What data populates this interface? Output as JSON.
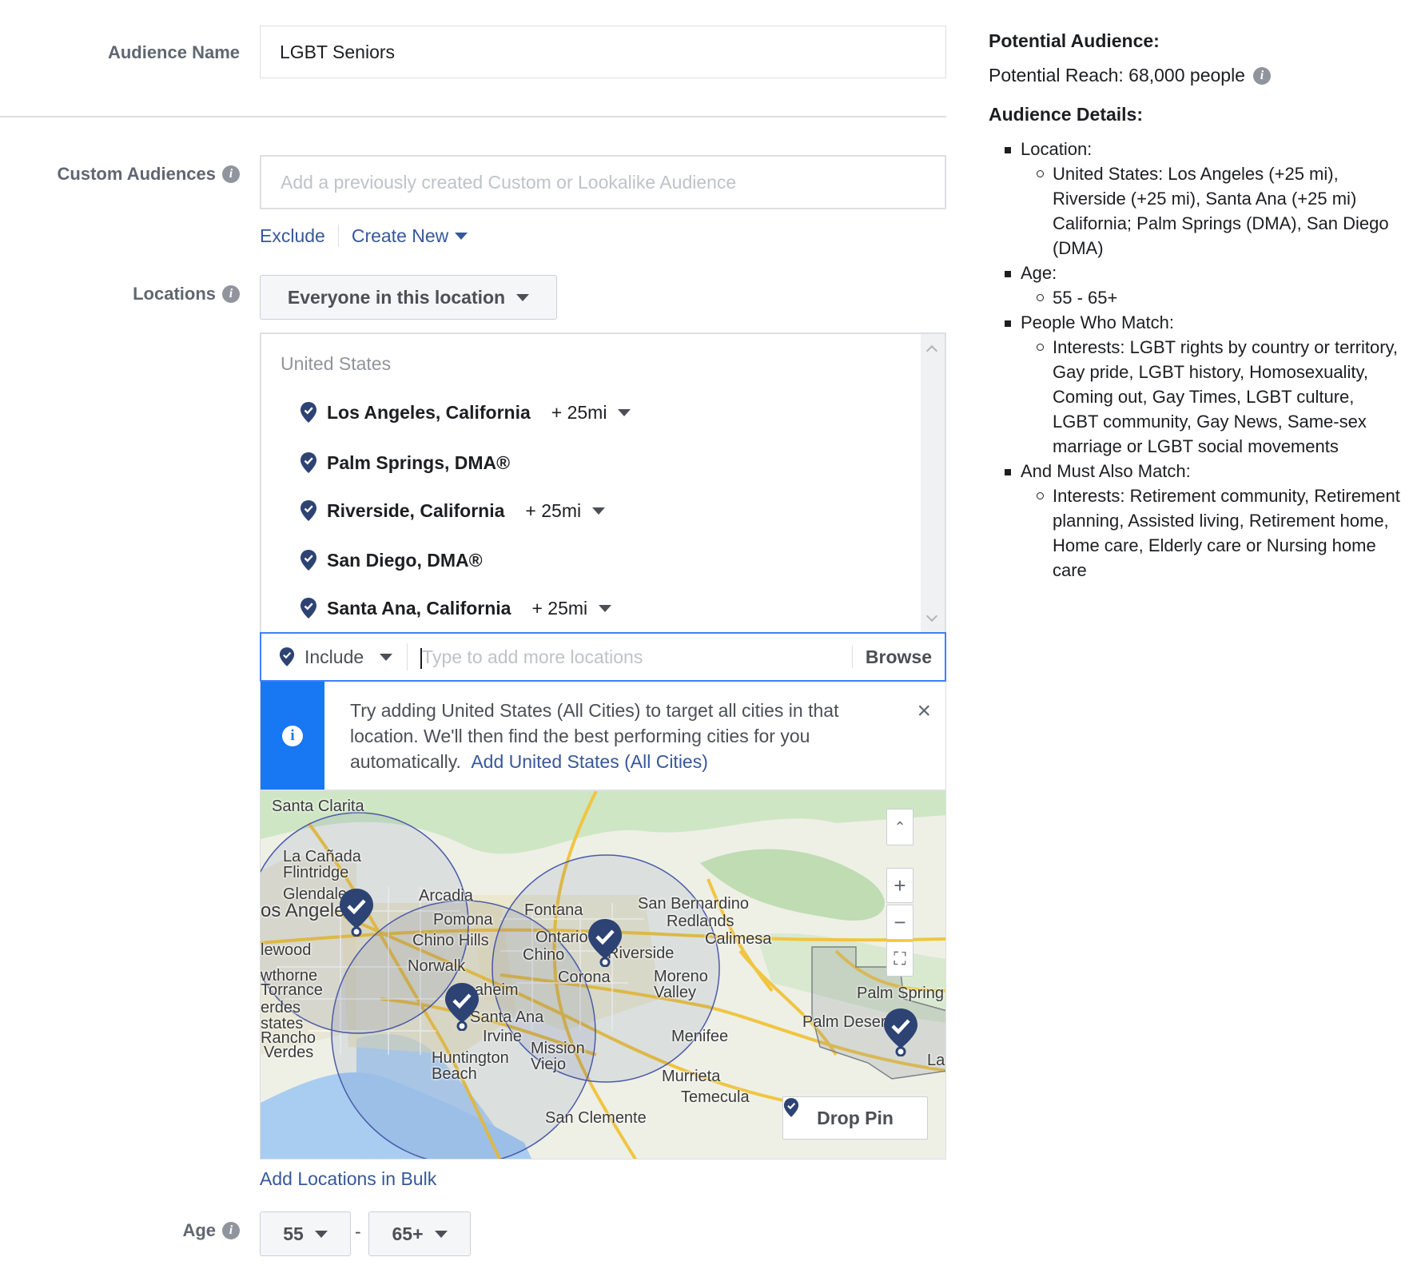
{
  "audience_name": {
    "label": "Audience Name",
    "value": "LGBT Seniors"
  },
  "custom_audiences": {
    "label": "Custom Audiences",
    "placeholder": "Add a previously created Custom or Lookalike Audience",
    "exclude_label": "Exclude",
    "create_new_label": "Create New"
  },
  "locations": {
    "label": "Locations",
    "mode_label": "Everyone in this location",
    "country": "United States",
    "items": [
      {
        "name": "Los Angeles, California",
        "radius": "+ 25mi"
      },
      {
        "name": "Palm Springs, DMA®",
        "radius": ""
      },
      {
        "name": "Riverside, California",
        "radius": "+ 25mi"
      },
      {
        "name": "San Diego, DMA®",
        "radius": ""
      },
      {
        "name": "Santa Ana, California",
        "radius": "+ 25mi"
      }
    ],
    "include_label": "Include",
    "input_placeholder": "Type to add more locations",
    "browse_label": "Browse",
    "tip": {
      "text": "Try adding United States (All Cities) to target all cities in that location. We'll then find the best performing cities for you automatically.",
      "link": "Add United States (All Cities)",
      "close": "×"
    },
    "map": {
      "labels": [
        "Santa Clarita",
        "La Cañada Flintridge",
        "Glendale",
        "os Angeles",
        "Arcadia",
        "Pomona",
        "Chino Hills",
        "Fontana",
        "San Bernardino",
        "Redlands",
        "Calimesa",
        "Ontario",
        "Chino",
        "Riverside",
        "lewood",
        "Norwalk",
        "wthorne",
        "Torrance",
        "Corona",
        "Moreno Valley",
        "erdes",
        "states",
        "Rancho",
        "Verdes",
        "aheim",
        "Santa Ana",
        "Irvine",
        "Mission Viejo",
        "Huntington Beach",
        "Menifee",
        "Murrieta",
        "Temecula",
        "San Clemente",
        "Palm Spring",
        "Palm Desert",
        "La"
      ],
      "zoom_in": "+",
      "zoom_out": "−",
      "collapse": "⌃",
      "fit": "⛶",
      "drop_pin_label": "Drop Pin"
    },
    "bulk_link": "Add Locations in Bulk"
  },
  "age": {
    "label": "Age",
    "min": "55",
    "separator": "-",
    "max": "65+"
  },
  "summary": {
    "potential_audience_title": "Potential Audience:",
    "potential_reach": "Potential Reach: 68,000 people",
    "details_title": "Audience Details:",
    "sections": [
      {
        "title": "Location:",
        "items": [
          "United States: Los Angeles (+25 mi), Riverside (+25 mi), Santa Ana (+25 mi) California; Palm Springs (DMA), San Diego (DMA)"
        ]
      },
      {
        "title": "Age:",
        "items": [
          "55 - 65+"
        ]
      },
      {
        "title": "People Who Match:",
        "items": [
          "Interests: LGBT rights by country or territory, Gay pride, LGBT history, Homosexuality, Coming out, Gay Times, LGBT culture, LGBT community, Gay News, Same-sex marriage or LGBT social movements"
        ]
      },
      {
        "title": "And Must Also Match:",
        "items": [
          "Interests: Retirement community, Retirement planning, Assisted living, Retirement home, Home care, Elderly care or Nursing home care"
        ]
      }
    ]
  },
  "colors": {
    "link": "#365899",
    "accent": "#1877f2",
    "pin": "#2d4373",
    "focus": "#4080ff"
  }
}
